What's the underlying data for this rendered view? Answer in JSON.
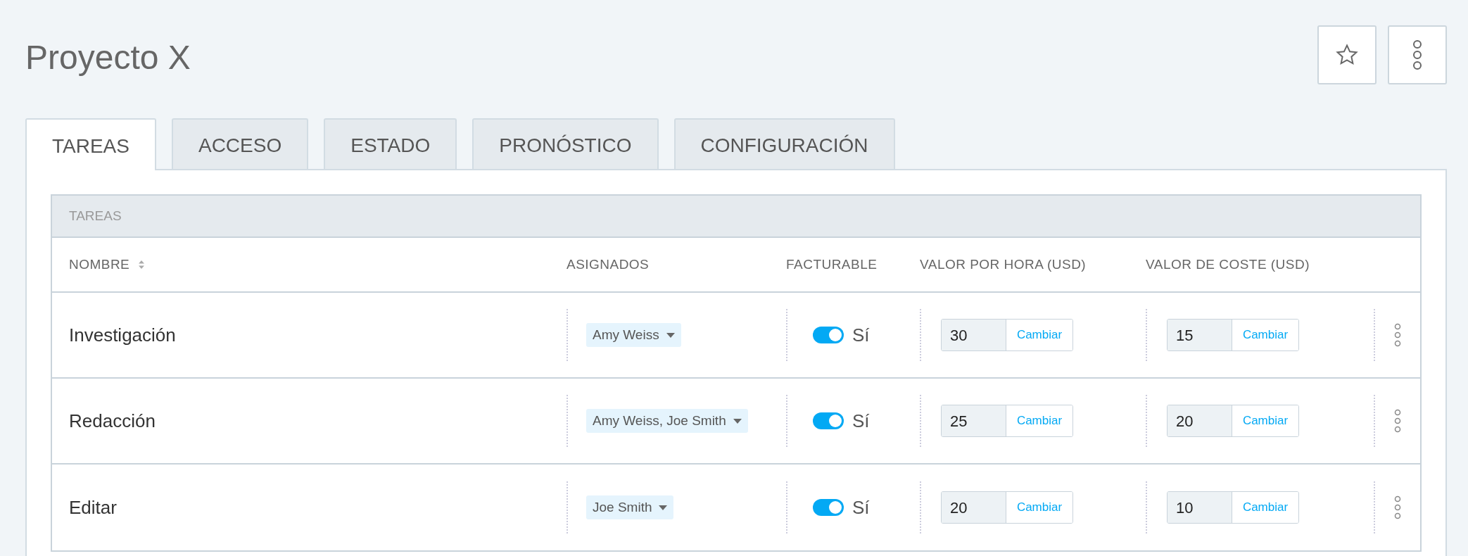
{
  "title": "Proyecto X",
  "tabs": [
    {
      "label": "TAREAS",
      "selected": true
    },
    {
      "label": "ACCESO",
      "selected": false
    },
    {
      "label": "ESTADO",
      "selected": false
    },
    {
      "label": "PRONÓSTICO",
      "selected": false
    },
    {
      "label": "CONFIGURACIÓN",
      "selected": false
    }
  ],
  "section_title": "TAREAS",
  "columns": [
    {
      "label": "NOMBRE",
      "sortable": true
    },
    {
      "label": "ASIGNADOS",
      "sortable": false
    },
    {
      "label": "FACTURABLE",
      "sortable": false
    },
    {
      "label": "VALOR POR HORA (USD)",
      "sortable": false
    },
    {
      "label": "VALOR DE COSTE (USD)",
      "sortable": false
    }
  ],
  "rows": [
    {
      "name": "Investigación",
      "assignees": "Amy Weiss",
      "billable": {
        "on": true,
        "label": "Sí"
      },
      "hourly_rate": {
        "value": "30",
        "button": "Cambiar"
      },
      "cost_rate": {
        "value": "15",
        "button": "Cambiar"
      }
    },
    {
      "name": "Redacción",
      "assignees": "Amy Weiss, Joe Smith",
      "billable": {
        "on": true,
        "label": "Sí"
      },
      "hourly_rate": {
        "value": "25",
        "button": "Cambiar"
      },
      "cost_rate": {
        "value": "20",
        "button": "Cambiar"
      }
    },
    {
      "name": "Editar",
      "assignees": "Joe Smith",
      "billable": {
        "on": true,
        "label": "Sí"
      },
      "hourly_rate": {
        "value": "20",
        "button": "Cambiar"
      },
      "cost_rate": {
        "value": "10",
        "button": "Cambiar"
      }
    }
  ]
}
